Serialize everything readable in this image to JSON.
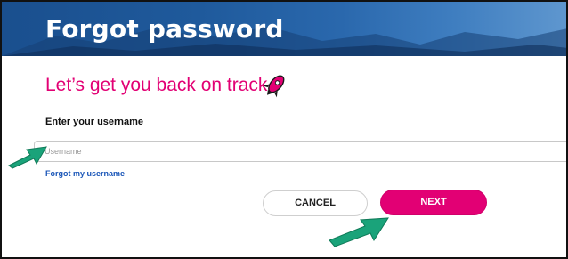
{
  "header": {
    "title": "Forgot password"
  },
  "main": {
    "subtitle": "Let’s get you back on track",
    "rocket_icon": "rocket-icon",
    "username_label": "Enter your username",
    "username_placeholder": "Username",
    "forgot_username_link": "Forgot my username"
  },
  "actions": {
    "cancel_label": "CANCEL",
    "next_label": "NEXT"
  },
  "colors": {
    "brand": "#e20074",
    "header": "#1f5a9c",
    "link": "#1a56b8",
    "annotation_arrow": "#1aa37a"
  }
}
